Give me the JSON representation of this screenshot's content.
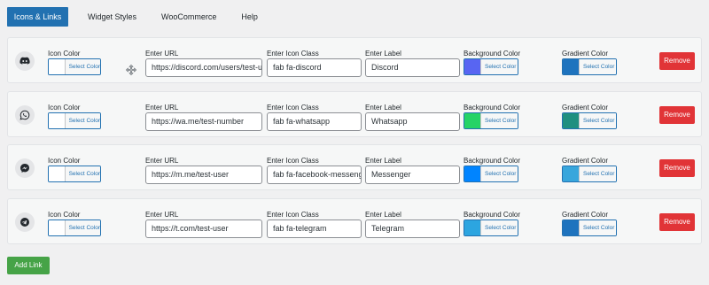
{
  "tabs": [
    {
      "label": "Icons & Links",
      "active": true
    },
    {
      "label": "Widget Styles",
      "active": false
    },
    {
      "label": "WooCommerce",
      "active": false
    },
    {
      "label": "Help",
      "active": false
    }
  ],
  "field_labels": {
    "icon_color": "Icon Color",
    "url": "Enter URL",
    "icon_class": "Enter Icon Class",
    "label": "Enter Label",
    "bg_color": "Background Color",
    "gradient_color": "Gradient Color"
  },
  "select_color_label": "Select Color",
  "remove_label": "Remove",
  "add_link_label": "Add Link",
  "rows": [
    {
      "icon": "discord-icon",
      "url": "https://discord.com/users/test-u",
      "icon_class": "fab fa-discord",
      "label": "Discord",
      "icon_color": "#ffffff",
      "bg_color": "#5865f2",
      "gradient_color": "#1e73be"
    },
    {
      "icon": "whatsapp-icon",
      "url": "https://wa.me/test-number",
      "icon_class": "fab fa-whatsapp",
      "label": "Whatsapp",
      "icon_color": "#ffffff",
      "bg_color": "#25d366",
      "gradient_color": "#1f8f7f"
    },
    {
      "icon": "messenger-icon",
      "url": "https://m.me/test-user",
      "icon_class": "fab fa-facebook-messeng",
      "label": "Messenger",
      "icon_color": "#ffffff",
      "bg_color": "#0084ff",
      "gradient_color": "#38a6dc"
    },
    {
      "icon": "telegram-icon",
      "url": "https://t.com/test-user",
      "icon_class": "fab fa-telegram",
      "label": "Telegram",
      "icon_color": "#ffffff",
      "bg_color": "#2ca5e0",
      "gradient_color": "#1e73be"
    }
  ]
}
